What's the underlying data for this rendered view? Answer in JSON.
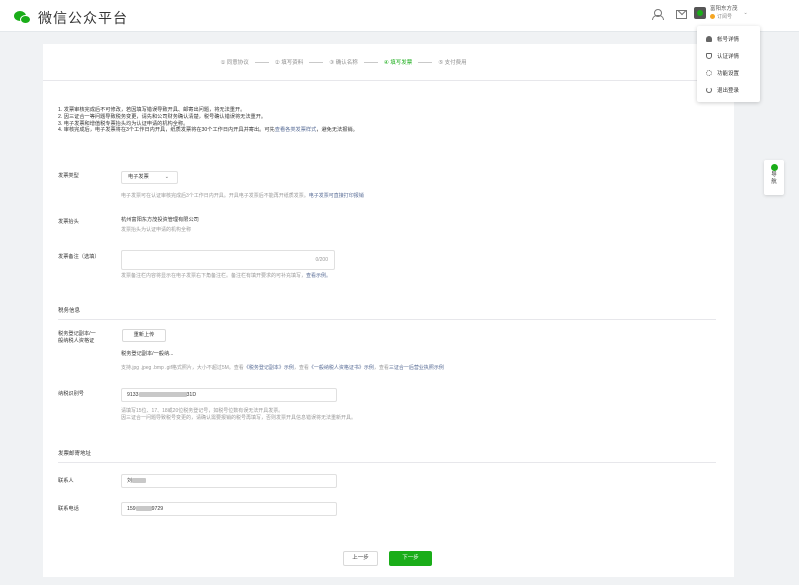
{
  "header": {
    "logo_text": "微信公众平台",
    "account_name": "富阳东方茂",
    "account_type": "订阅号"
  },
  "menu": {
    "items": [
      {
        "label": "帐号详情",
        "icon": "user-icon"
      },
      {
        "label": "认证详情",
        "icon": "shield-icon"
      },
      {
        "label": "功能设置",
        "icon": "gear-icon"
      },
      {
        "label": "退出登录",
        "icon": "power-icon"
      }
    ]
  },
  "steps": [
    {
      "label": "① 同意协议"
    },
    {
      "label": "② 填写资料"
    },
    {
      "label": "③ 确认名称"
    },
    {
      "label": "④ 填写发票"
    },
    {
      "label": "⑤ 支付费用"
    }
  ],
  "notes": {
    "line1": "1. 发票审核完成后不可修改，若因填写错误导致开具、邮寄出问题，将无法重开。",
    "line2": "2. 因三证合一等问题导致税务变更，请先和公司财务确认清楚，税号确认错误将无法重开。",
    "line3": "3. 电子发票和增值税专票抬头均为认证申请的机构全称。",
    "line4a": "4. 审核完成后，电子发票将在3个工作日内开具，纸质发票将在30个工作日内开具并寄出。可先",
    "line4_link": "查看各类发票样式",
    "line4b": "，避免无法报销。"
  },
  "invoice_type": {
    "label": "发票类型",
    "value": "电子发票",
    "hint": "电子发票可在认证审核完成后3个工作日内开具。开具电子发票后不能再开纸质发票。",
    "hint_link": "电子发票可直接打印报销"
  },
  "invoice_title": {
    "label": "发票抬头",
    "value": "杭州富阳东方茂投资管理有限公司",
    "hint": "发票抬头为认证申请的机构全称"
  },
  "invoice_remark": {
    "label": "发票备注（选填）",
    "counter": "0/200",
    "hint": "发票备注栏内容将显示在电子发票右下角备注栏。备注栏有填开要求的可补充填写，",
    "hint_link": "查看示例。"
  },
  "tax_section": {
    "title": "税务信息",
    "cert_label_1": "税务登记副本/一",
    "cert_label_2": "般纳税人资格证",
    "reupload_button": "重新上传",
    "file_name": "税务登记副本/一般纳...",
    "file_hint": "支持.jpg .jpeg .bmp .gif格式照片，大小不超过5M。查看",
    "file_link1": "《税务登记副本》示例",
    "file_mid": "，查看",
    "file_link2": "《一般纳税人资格证书》示例",
    "file_mid2": "，查看",
    "file_link3": "三证合一后营业执照示例",
    "tax_id_label": "纳税识别号",
    "tax_id_prefix": "9133",
    "tax_id_suffix": "31D",
    "tax_hint_1": "请填写15位、17、18或20位税务登记号，如税号位数有误无法开具发票。",
    "tax_hint_2": "因三证合一问题导致税号变更的，请确认需要报销的税号再填写，否则发票开具信息错误将无法重新开具。"
  },
  "mail_section": {
    "title": "发票邮寄地址",
    "contact_label": "联系人",
    "contact_prefix": "刘",
    "phone_label": "联系电话",
    "phone_prefix": "159",
    "phone_suffix": "9729"
  },
  "footer": {
    "prev_button": "上一步",
    "next_button": "下一步"
  },
  "side_guide": {
    "label_1": "导",
    "label_2": "航"
  }
}
